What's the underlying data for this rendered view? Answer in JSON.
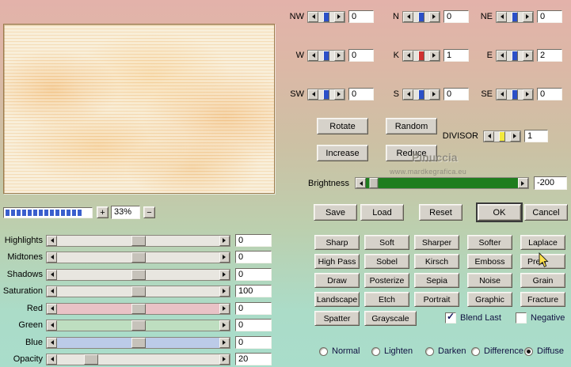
{
  "colors": {
    "background_top": "#e3b2aa",
    "background_bottom": "#a9ddcb",
    "button_face": "#d6d2ca",
    "progress_blue": "#3a5fcd"
  },
  "zoom": {
    "plus": "+",
    "value": "33%",
    "minus": "−",
    "bar_color": "#3a5fcd",
    "bar_segments": 14
  },
  "adjustments": [
    {
      "label": "Highlights",
      "value": "0",
      "pos": 50,
      "track": "#e8e6e0"
    },
    {
      "label": "Midtones",
      "value": "0",
      "pos": 50,
      "track": "#e8e6e0"
    },
    {
      "label": "Shadows",
      "value": "0",
      "pos": 50,
      "track": "#e8e6e0"
    },
    {
      "label": "Saturation",
      "value": "100",
      "pos": 50,
      "track": "#e8e6e0"
    },
    {
      "label": "Red",
      "value": "0",
      "pos": 50,
      "track": "#e9c2c6"
    },
    {
      "label": "Green",
      "value": "0",
      "pos": 50,
      "track": "#bedec0"
    },
    {
      "label": "Blue",
      "value": "0",
      "pos": 50,
      "track": "#bccbe8"
    },
    {
      "label": "Opacity",
      "value": "20",
      "pos": 21,
      "track": "#e8e6e0"
    }
  ],
  "kernel": {
    "cells": [
      {
        "label": "NW",
        "value": "0",
        "thumb": "#2b50c8"
      },
      {
        "label": "N",
        "value": "0",
        "thumb": "#2b50c8"
      },
      {
        "label": "NE",
        "value": "0",
        "thumb": "#2b50c8"
      },
      {
        "label": "W",
        "value": "0",
        "thumb": "#2b50c8"
      },
      {
        "label": "K",
        "value": "1",
        "thumb": "#d03030"
      },
      {
        "label": "E",
        "value": "2",
        "thumb": "#2b50c8"
      },
      {
        "label": "SW",
        "value": "0",
        "thumb": "#2b50c8"
      },
      {
        "label": "S",
        "value": "0",
        "thumb": "#2b50c8"
      },
      {
        "label": "SE",
        "value": "0",
        "thumb": "#2b50c8"
      }
    ],
    "divisor": {
      "label": "DIVISOR",
      "value": "1",
      "thumb": "#f2e93c"
    }
  },
  "kernel_buttons": {
    "rotate": "Rotate",
    "random": "Random",
    "increase": "Increase",
    "reduce": "Reduce"
  },
  "brightness": {
    "label": "Brightness",
    "value": "-200",
    "track": "#1e7d1e",
    "pos": 5
  },
  "actions": {
    "save": "Save",
    "load": "Load",
    "reset": "Reset",
    "ok": "OK",
    "cancel": "Cancel"
  },
  "filters": [
    "Sharp",
    "Soft",
    "Sharper",
    "Softer",
    "Laplace",
    "High Pass",
    "Sobel",
    "Kirsch",
    "Emboss",
    "Prew",
    "Draw",
    "Posterize",
    "Sepia",
    "Noise",
    "Grain",
    "Landscape",
    "Etch",
    "Portrait",
    "Graphic",
    "Fracture",
    "Spatter",
    "Grayscale"
  ],
  "options": {
    "blend_last": {
      "label": "Blend Last",
      "checked": true
    },
    "negative": {
      "label": "Negative",
      "checked": false
    }
  },
  "blend_modes": [
    {
      "label": "Normal",
      "selected": false
    },
    {
      "label": "Lighten",
      "selected": false
    },
    {
      "label": "Darken",
      "selected": false
    },
    {
      "label": "Difference",
      "selected": false
    },
    {
      "label": "Diffuse",
      "selected": true
    }
  ],
  "watermark": {
    "title": "Pinuccia",
    "url": "www.mardkegrafica.eu"
  }
}
